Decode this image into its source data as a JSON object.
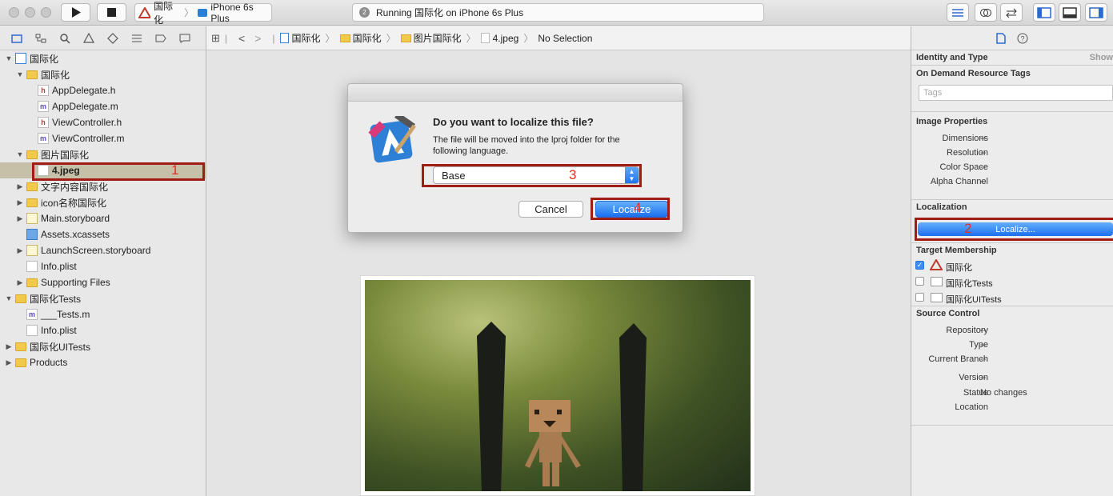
{
  "toolbar": {
    "scheme_target": "国际化",
    "scheme_device": "iPhone 6s Plus",
    "activity_badge": "2",
    "activity_text": "Running 国际化 on iPhone 6s Plus"
  },
  "navigator": {
    "rows": [
      {
        "label": "国际化",
        "kind": "proj",
        "tri": "▼"
      },
      {
        "label": "国际化",
        "kind": "folder",
        "tri": "▼"
      },
      {
        "label": "AppDelegate.h",
        "kind": "hfile",
        "tri": ""
      },
      {
        "label": "AppDelegate.m",
        "kind": "mfile",
        "tri": ""
      },
      {
        "label": "ViewController.h",
        "kind": "hfile",
        "tri": ""
      },
      {
        "label": "ViewController.m",
        "kind": "mfile",
        "tri": ""
      },
      {
        "label": "图片国际化",
        "kind": "folder",
        "tri": "▼"
      },
      {
        "label": "4.jpeg",
        "kind": "doc",
        "tri": ""
      },
      {
        "label": "文字内容国际化",
        "kind": "folder",
        "tri": "▶"
      },
      {
        "label": "icon名称国际化",
        "kind": "folder",
        "tri": "▶"
      },
      {
        "label": "Main.storyboard",
        "kind": "sb",
        "tri": "▶"
      },
      {
        "label": "Assets.xcassets",
        "kind": "assets",
        "tri": ""
      },
      {
        "label": "LaunchScreen.storyboard",
        "kind": "sb",
        "tri": "▶"
      },
      {
        "label": "Info.plist",
        "kind": "doc",
        "tri": ""
      },
      {
        "label": "Supporting Files",
        "kind": "folder",
        "tri": "▶"
      },
      {
        "label": "国际化Tests",
        "kind": "folder",
        "tri": "▼"
      },
      {
        "label": "___Tests.m",
        "kind": "mfile",
        "tri": ""
      },
      {
        "label": "Info.plist",
        "kind": "doc",
        "tri": ""
      },
      {
        "label": "国际化UITests",
        "kind": "folder",
        "tri": "▶"
      },
      {
        "label": "Products",
        "kind": "folder",
        "tri": "▶"
      }
    ]
  },
  "jumpbar": {
    "crumbs": [
      "国际化",
      "国际化",
      "图片国际化",
      "4.jpeg"
    ],
    "selection": "No Selection"
  },
  "dialog": {
    "title": "Do you want to localize this file?",
    "message": "The file will be moved into the lproj folder for the following language.",
    "selected_language": "Base",
    "cancel_label": "Cancel",
    "localize_label": "Localize"
  },
  "annotations": [
    "1",
    "2",
    "3",
    "4"
  ],
  "inspector": {
    "identity_title": "Identity and Type",
    "show_label": "Show",
    "odr_title": "On Demand Resource Tags",
    "tags_placeholder": "Tags",
    "image_props_title": "Image Properties",
    "image_props": [
      {
        "label": "Dimensions",
        "value": "--"
      },
      {
        "label": "Resolution",
        "value": "--"
      },
      {
        "label": "Color Space",
        "value": "--"
      },
      {
        "label": "Alpha Channel",
        "value": "--"
      }
    ],
    "localization_title": "Localization",
    "localize_button": "Localize...",
    "target_title": "Target Membership",
    "targets": [
      {
        "label": "国际化",
        "checked": true
      },
      {
        "label": "国际化Tests",
        "checked": false
      },
      {
        "label": "国际化UITests",
        "checked": false
      }
    ],
    "source_control_title": "Source Control",
    "source_control": [
      {
        "label": "Repository",
        "value": "--"
      },
      {
        "label": "Type",
        "value": "--"
      },
      {
        "label": "Current Branch",
        "value": "--"
      },
      {
        "label": "Version",
        "value": "--"
      },
      {
        "label": "Status",
        "value": "No changes"
      },
      {
        "label": "Location",
        "value": ""
      }
    ]
  },
  "colors": {
    "accent_blue": "#1b6ff0",
    "annotation_red": "#a01c14",
    "selection": "#c6c0a8"
  }
}
